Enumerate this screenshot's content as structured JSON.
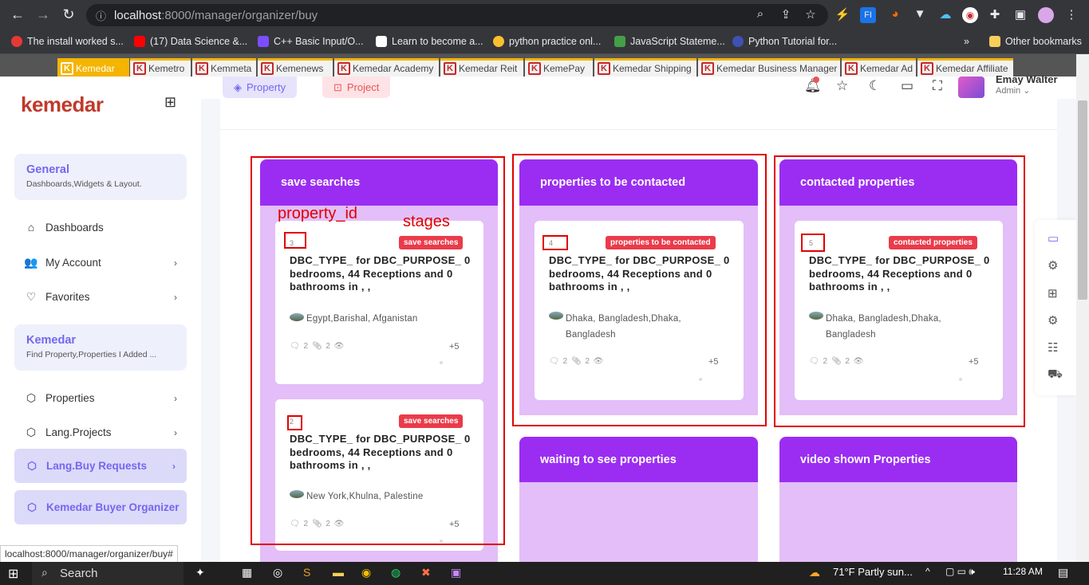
{
  "browser": {
    "url_host": "localhost",
    "url_path": ":8000/manager/organizer/buy",
    "status_url": "localhost:8000/manager/organizer/buy#"
  },
  "bookmarks": [
    "The install worked s...",
    "(17) Data Science &...",
    "C++ Basic Input/O...",
    "Learn to become a...",
    "python practice onl...",
    "JavaScript Stateme...",
    "Python Tutorial for...",
    "Other bookmarks"
  ],
  "kemedar_tabs": [
    "Kemedar",
    "Kemetro",
    "Kemmeta",
    "Kemenews",
    "Kemedar Academy",
    "Kemedar Reit",
    "KemePay",
    "Kemedar Shipping",
    "Kemedar Business Manager",
    "Kemedar Ad",
    "Kemedar Affiliate"
  ],
  "sidebar": {
    "brand": "kemedar",
    "group_general": {
      "title": "General",
      "subtitle": "Dashboards,Widgets & Layout."
    },
    "items_top": [
      "Dashboards",
      "My Account",
      "Favorites"
    ],
    "group_kemedar": {
      "title": "Kemedar",
      "subtitle": "Find Property,Properties I Added ..."
    },
    "items_bottom": [
      "Properties",
      "Lang.Projects"
    ],
    "active_items": [
      "Lang.Buy Requests",
      "Kemedar Buyer Organizer"
    ]
  },
  "header": {
    "tab_property": "Property",
    "tab_project": "Project",
    "user_name": "Emay Walter",
    "user_role": "Admin"
  },
  "annotations": {
    "property_id": "property_id",
    "stages": "stages"
  },
  "columns": [
    {
      "title": "save searches",
      "cards": [
        {
          "id": "3",
          "badge": "save searches",
          "title": "DBC_TYPE_ for DBC_PURPOSE_ 0 bedrooms, 44 Receptions and 0 bathrooms in , ,",
          "location": "Egypt,Barishal, Afganistan",
          "comments": "2",
          "attachments": "2",
          "plus": "+5"
        },
        {
          "id": "2",
          "badge": "save searches",
          "title": "DBC_TYPE_ for DBC_PURPOSE_ 0 bedrooms, 44 Receptions and 0 bathrooms in , ,",
          "location": "New York,Khulna, Palestine",
          "comments": "2",
          "attachments": "2",
          "plus": "+5"
        }
      ]
    },
    {
      "title": "properties to be contacted",
      "cards": [
        {
          "id": "4",
          "badge": "properties to be contacted",
          "title": "DBC_TYPE_ for DBC_PURPOSE_ 0 bedrooms, 44 Receptions and 0 bathrooms in , ,",
          "location": "Dhaka, Bangladesh,Dhaka, Bangladesh",
          "comments": "2",
          "attachments": "2",
          "plus": "+5"
        }
      ]
    },
    {
      "title": "contacted properties",
      "cards": [
        {
          "id": "5",
          "badge": "contacted properties",
          "title": "DBC_TYPE_ for DBC_PURPOSE_ 0 bedrooms, 44 Receptions and 0 bathrooms in , ,",
          "location": "Dhaka, Bangladesh,Dhaka, Bangladesh",
          "comments": "2",
          "attachments": "2",
          "plus": "+5"
        }
      ]
    },
    {
      "title": "waiting to see properties",
      "cards": []
    },
    {
      "title": "video shown Properties",
      "cards": []
    }
  ],
  "taskbar": {
    "search_label": "Search",
    "weather": "71°F  Partly sun...",
    "time": "11:28 AM"
  },
  "colors": {
    "accent": "#9b2df2",
    "column_bg": "#e3bef8",
    "badge": "#ea3b4a",
    "annotation": "#e00000"
  }
}
